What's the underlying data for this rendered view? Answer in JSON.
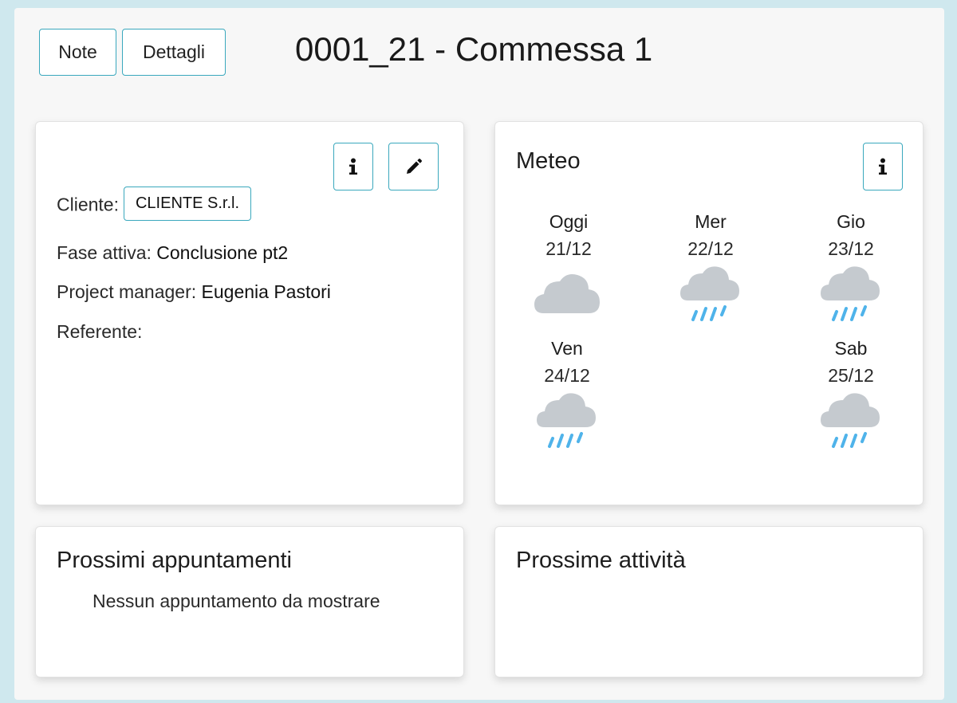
{
  "header": {
    "note_label": "Note",
    "dettagli_label": "Dettagli",
    "title": "0001_21 - Commessa 1"
  },
  "project_card": {
    "cliente_label": "Cliente:",
    "cliente_value": "CLIENTE S.r.l.",
    "fase_label": "Fase attiva:",
    "fase_value": "Conclusione pt2",
    "pm_label": "Project manager:",
    "pm_value": "Eugenia Pastori",
    "referente_label": "Referente:"
  },
  "meteo": {
    "title": "Meteo",
    "days": [
      {
        "name": "Oggi",
        "date": "21/12",
        "icon": "cloud-icon"
      },
      {
        "name": "Mer",
        "date": "22/12",
        "icon": "rain-icon"
      },
      {
        "name": "Gio",
        "date": "23/12",
        "icon": "rain-icon"
      },
      {
        "name": "Ven",
        "date": "24/12",
        "icon": "rain-icon"
      },
      {
        "name": "Sab",
        "date": "25/12",
        "icon": "rain-icon"
      }
    ]
  },
  "appuntamenti": {
    "title": "Prossimi appuntamenti",
    "empty": "Nessun appuntamento da mostrare"
  },
  "attivita": {
    "title": "Prossime attività"
  },
  "colors": {
    "accent": "#3aa8bd",
    "cloud": "#c5cacf",
    "rain": "#4fb3ea"
  }
}
